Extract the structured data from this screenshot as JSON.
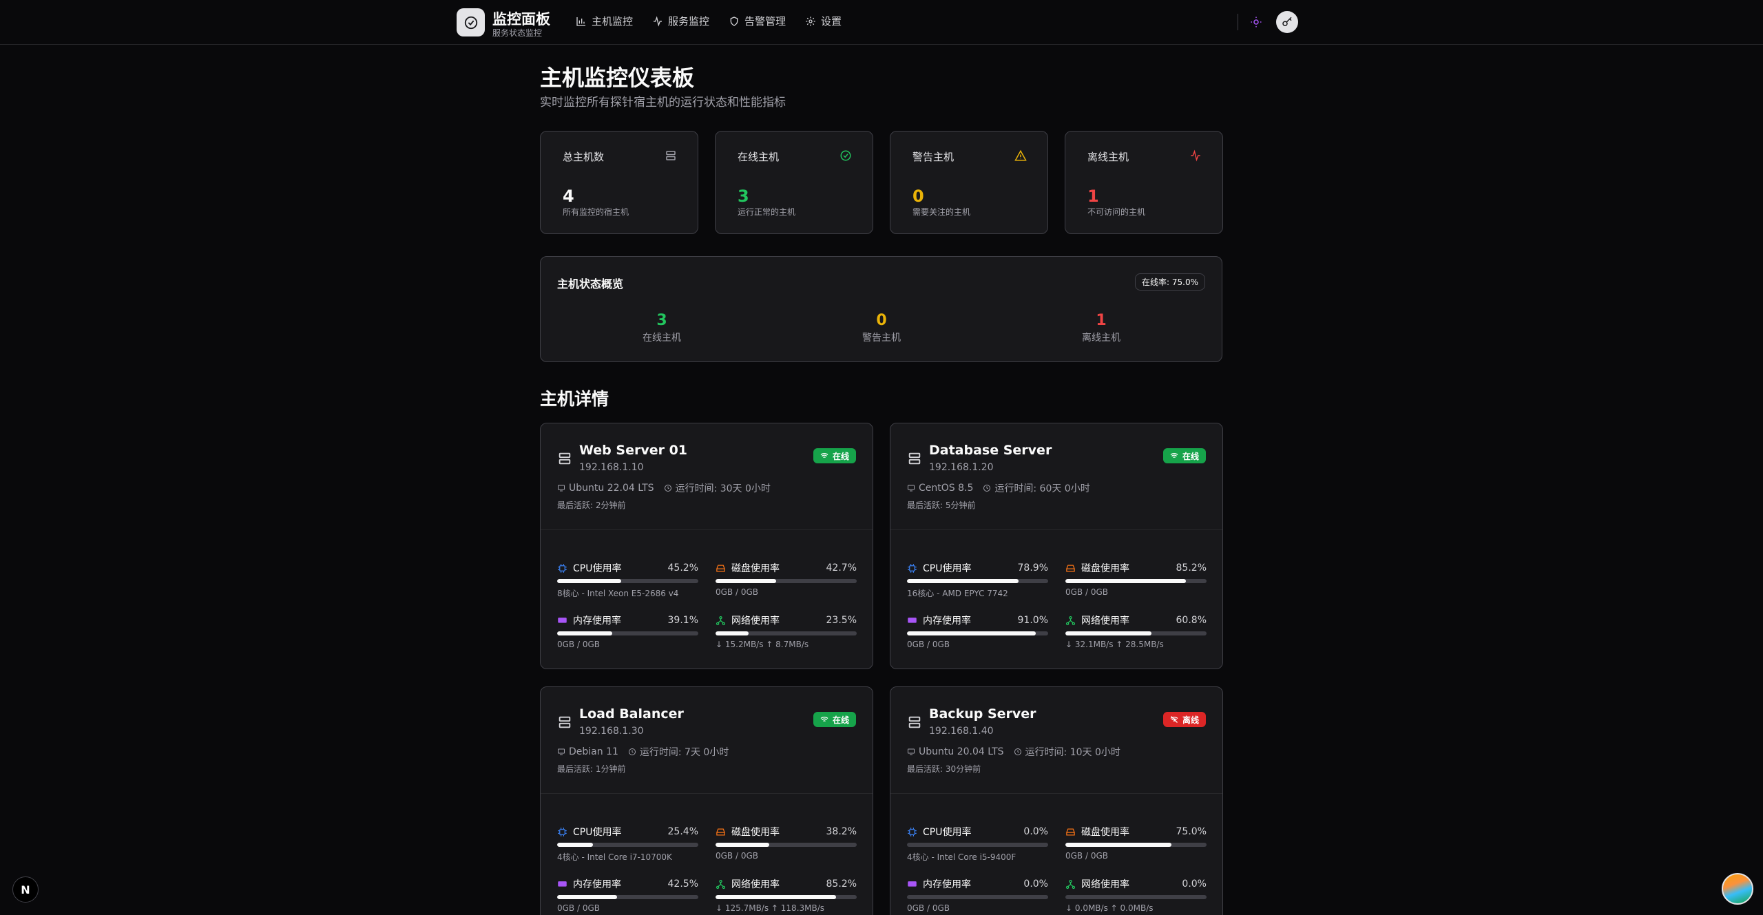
{
  "header": {
    "brand_title": "监控面板",
    "brand_sub": "服务状态监控",
    "nav": [
      {
        "label": "主机监控",
        "icon": "bar-chart-icon"
      },
      {
        "label": "服务监控",
        "icon": "activity-icon"
      },
      {
        "label": "告警管理",
        "icon": "shield-icon"
      },
      {
        "label": "设置",
        "icon": "gear-icon"
      }
    ]
  },
  "page": {
    "title": "主机监控仪表板",
    "subtitle": "实时监控所有探针宿主机的运行状态和性能指标"
  },
  "stats": [
    {
      "label": "总主机数",
      "value": "4",
      "desc": "所有监控的宿主机",
      "color": "#fafafa",
      "icon": "server-icon"
    },
    {
      "label": "在线主机",
      "value": "3",
      "desc": "运行正常的主机",
      "color": "#22c55e",
      "icon": "check-circle-icon"
    },
    {
      "label": "警告主机",
      "value": "0",
      "desc": "需要关注的主机",
      "color": "#eab308",
      "icon": "warning-icon"
    },
    {
      "label": "离线主机",
      "value": "1",
      "desc": "不可访问的主机",
      "color": "#ef4444",
      "icon": "activity-icon"
    }
  ],
  "overview": {
    "title": "主机状态概览",
    "badge": "在线率: 75.0%",
    "cols": [
      {
        "value": "3",
        "label": "在线主机",
        "color": "#22c55e"
      },
      {
        "value": "0",
        "label": "警告主机",
        "color": "#eab308"
      },
      {
        "value": "1",
        "label": "离线主机",
        "color": "#ef4444"
      }
    ]
  },
  "section_title": "主机详情",
  "hosts": [
    {
      "name": "Web Server 01",
      "ip": "192.168.1.10",
      "status": "在线",
      "online": true,
      "os": "Ubuntu 22.04 LTS",
      "uptime": "运行时间: 30天 0小时",
      "last": "最后活跃: 2分钟前",
      "cpu": {
        "label": "CPU使用率",
        "value": "45.2%",
        "pct": 45.2,
        "sub": "8核心 - Intel Xeon E5-2686 v4"
      },
      "disk": {
        "label": "磁盘使用率",
        "value": "42.7%",
        "pct": 42.7,
        "sub": "0GB / 0GB"
      },
      "mem": {
        "label": "内存使用率",
        "value": "39.1%",
        "pct": 39.1,
        "sub": "0GB / 0GB"
      },
      "net": {
        "label": "网络使用率",
        "value": "23.5%",
        "pct": 23.5,
        "sub": "↓ 15.2MB/s ↑ 8.7MB/s"
      }
    },
    {
      "name": "Database Server",
      "ip": "192.168.1.20",
      "status": "在线",
      "online": true,
      "os": "CentOS 8.5",
      "uptime": "运行时间: 60天 0小时",
      "last": "最后活跃: 5分钟前",
      "cpu": {
        "label": "CPU使用率",
        "value": "78.9%",
        "pct": 78.9,
        "sub": "16核心 - AMD EPYC 7742"
      },
      "disk": {
        "label": "磁盘使用率",
        "value": "85.2%",
        "pct": 85.2,
        "sub": "0GB / 0GB"
      },
      "mem": {
        "label": "内存使用率",
        "value": "91.0%",
        "pct": 91.0,
        "sub": "0GB / 0GB"
      },
      "net": {
        "label": "网络使用率",
        "value": "60.8%",
        "pct": 60.8,
        "sub": "↓ 32.1MB/s ↑ 28.5MB/s"
      }
    },
    {
      "name": "Load Balancer",
      "ip": "192.168.1.30",
      "status": "在线",
      "online": true,
      "os": "Debian 11",
      "uptime": "运行时间: 7天 0小时",
      "last": "最后活跃: 1分钟前",
      "cpu": {
        "label": "CPU使用率",
        "value": "25.4%",
        "pct": 25.4,
        "sub": "4核心 - Intel Core i7-10700K"
      },
      "disk": {
        "label": "磁盘使用率",
        "value": "38.2%",
        "pct": 38.2,
        "sub": "0GB / 0GB"
      },
      "mem": {
        "label": "内存使用率",
        "value": "42.5%",
        "pct": 42.5,
        "sub": "0GB / 0GB"
      },
      "net": {
        "label": "网络使用率",
        "value": "85.2%",
        "pct": 85.2,
        "sub": "↓ 125.7MB/s ↑ 118.3MB/s"
      }
    },
    {
      "name": "Backup Server",
      "ip": "192.168.1.40",
      "status": "离线",
      "online": false,
      "os": "Ubuntu 20.04 LTS",
      "uptime": "运行时间: 10天 0小时",
      "last": "最后活跃: 30分钟前",
      "cpu": {
        "label": "CPU使用率",
        "value": "0.0%",
        "pct": 0.0,
        "sub": "4核心 - Intel Core i5-9400F"
      },
      "disk": {
        "label": "磁盘使用率",
        "value": "75.0%",
        "pct": 75.0,
        "sub": "0GB / 0GB"
      },
      "mem": {
        "label": "内存使用率",
        "value": "0.0%",
        "pct": 0.0,
        "sub": "0GB / 0GB"
      },
      "net": {
        "label": "网络使用率",
        "value": "0.0%",
        "pct": 0.0,
        "sub": "↓ 0.0MB/s ↑ 0.0MB/s"
      }
    }
  ],
  "colors": {
    "online": "#16a34a",
    "offline": "#dc2626",
    "cpu": "#3b82f6",
    "disk": "#f97316",
    "mem": "#a855f7",
    "net": "#22c55e"
  },
  "fab_letter": "N"
}
